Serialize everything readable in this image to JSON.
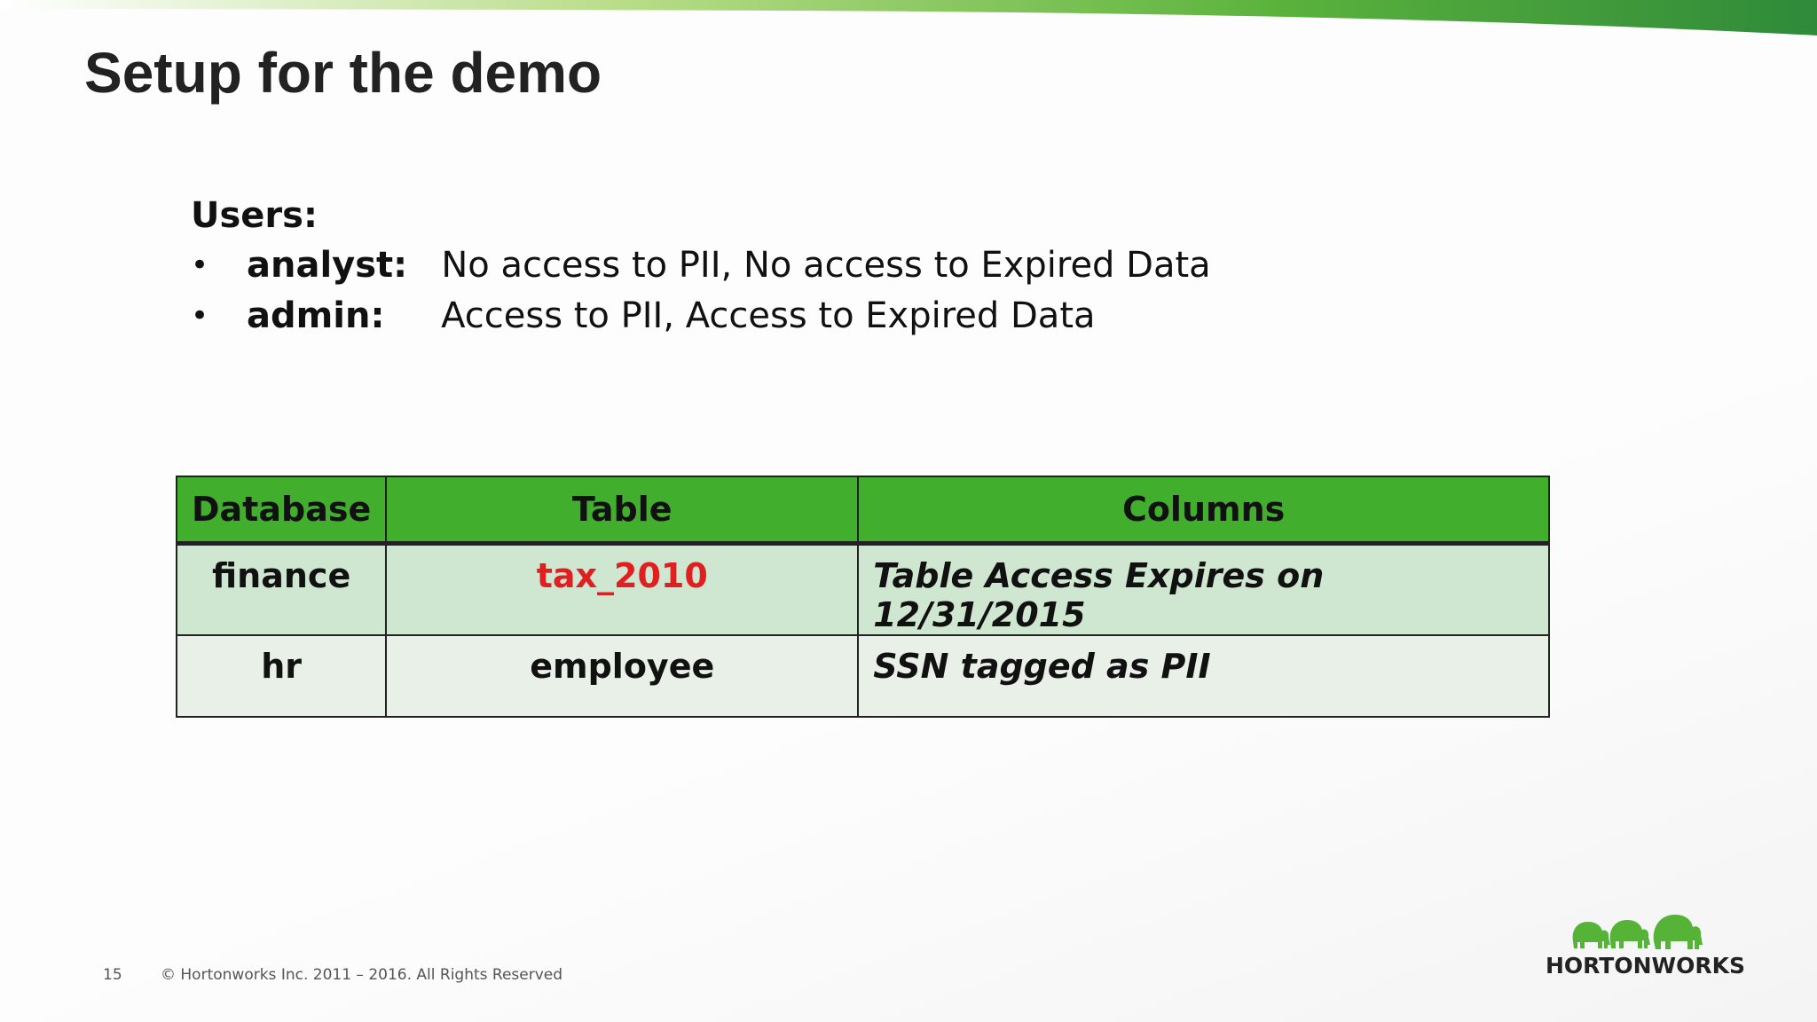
{
  "slide": {
    "title": "Setup for the demo",
    "page_number": "15",
    "copyright": "© Hortonworks Inc. 2011 – 2016. All Rights Reserved",
    "logo_text": "HORTONWORKS",
    "logo_icon": "elephants-logo-icon"
  },
  "users": {
    "heading": "Users:",
    "items": [
      {
        "name": "analyst:",
        "description": "No access to PII, No access to Expired Data"
      },
      {
        "name": "admin:",
        "description": "Access to PII, Access to Expired Data"
      }
    ]
  },
  "table": {
    "headers": [
      "Database",
      "Table",
      "Columns"
    ],
    "rows": [
      {
        "database": "finance",
        "table": "tax_2010",
        "columns": "Table Access Expires on 12/31/2015"
      },
      {
        "database": "hr",
        "table": "employee",
        "columns": "SSN tagged as PII"
      }
    ]
  },
  "colors": {
    "header_green": "#42ae2d",
    "row_light_green": "#cfe6d0",
    "row_pale_green": "#e8f0e7",
    "highlight_red": "#e02020",
    "logo_green": "#55b437"
  }
}
